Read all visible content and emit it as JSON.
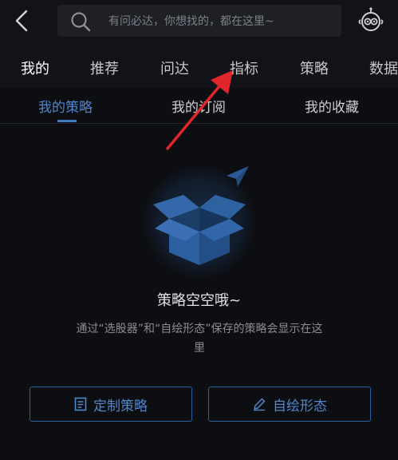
{
  "header": {
    "back_icon": "chevron-left-icon",
    "search_icon": "search-icon",
    "search_placeholder": "有问必达，你想找的，都在这里~",
    "robot_icon": "robot-assistant-icon"
  },
  "nav": {
    "tabs": [
      {
        "label": "我的",
        "active": true
      },
      {
        "label": "推荐"
      },
      {
        "label": "问达"
      },
      {
        "label": "指标"
      },
      {
        "label": "策略"
      },
      {
        "label": "数据"
      }
    ]
  },
  "subtabs": {
    "tabs": [
      {
        "label": "我的策略",
        "active": true
      },
      {
        "label": "我的订阅"
      },
      {
        "label": "我的收藏"
      }
    ]
  },
  "empty_state": {
    "illustration_icon": "open-box-icon",
    "title": "策略空空哦~",
    "description": "通过“选股器”和“自绘形态”保存的策略会显示在这里"
  },
  "actions": {
    "custom_strategy_label": "定制策略",
    "custom_strategy_icon": "document-icon",
    "draw_pattern_label": "自绘形态",
    "draw_pattern_icon": "pencil-icon"
  },
  "colors": {
    "background": "#0d0e12",
    "accent": "#4f86cc",
    "annotation_arrow": "#e0262a"
  }
}
